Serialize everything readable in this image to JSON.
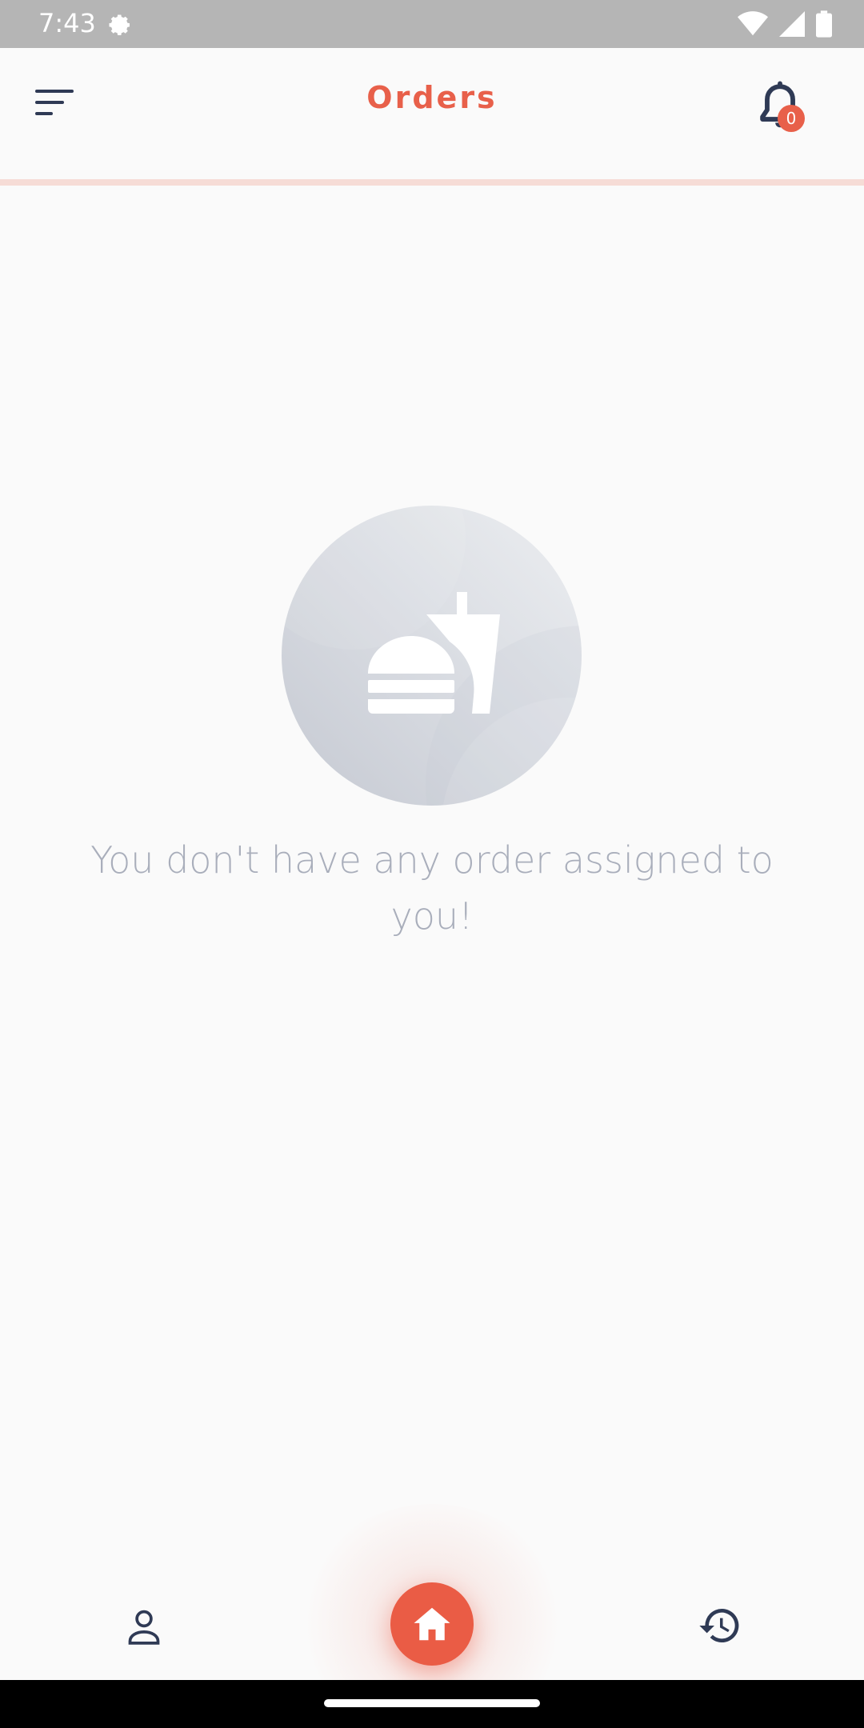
{
  "status_bar": {
    "time": "7:43",
    "icons": [
      "settings-icon",
      "wifi-icon",
      "signal-icon",
      "battery-icon"
    ]
  },
  "app_bar": {
    "title": "Orders",
    "menu_icon": "menu-sort-icon",
    "notification_icon": "bell-icon",
    "notification_count": "0"
  },
  "empty_state": {
    "illustration": "burger-drink-icon",
    "message": "You don't have any order assigned to you!"
  },
  "bottom_nav": {
    "items": [
      {
        "icon": "profile-icon"
      },
      {
        "icon": "home-icon",
        "active": true
      },
      {
        "icon": "history-icon"
      }
    ]
  },
  "colors": {
    "accent": "#e8604a",
    "text_muted": "#a9aebb",
    "icon_dark": "#2f3a55"
  }
}
